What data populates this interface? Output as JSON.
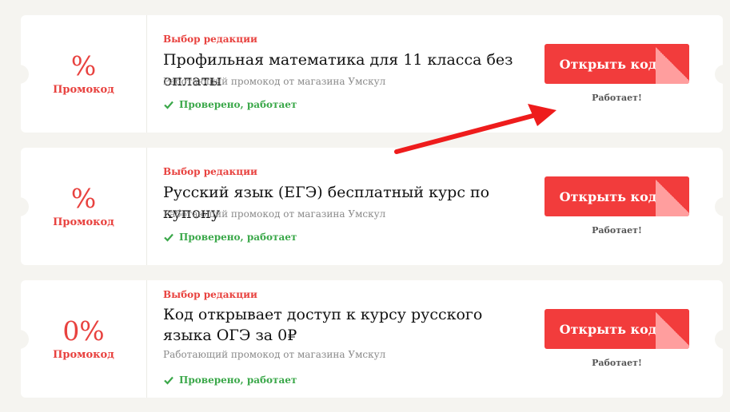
{
  "coupons": [
    {
      "discount": "%",
      "label": "Промокод",
      "editor": "Выбор редакции",
      "title": "Профильная математика для 11 класса без оплаты",
      "shop": "Работающий промокод от магазина Умскул",
      "verified": "Проверено, работает",
      "button": "Открыть код",
      "status": "Работает!"
    },
    {
      "discount": "%",
      "label": "Промокод",
      "editor": "Выбор редакции",
      "title": "Русский язык (ЕГЭ) бесплатный курс по купону",
      "shop": "Работающий промокод от магазина Умскул",
      "verified": "Проверено, работает",
      "button": "Открыть код",
      "status": "Работает!"
    },
    {
      "discount": "0%",
      "label": "Промокод",
      "editor": "Выбор редакции",
      "title": "Код открывает доступ к курсу русского языка ОГЭ за 0₽",
      "shop": "Работающий промокод от магазина Умскул",
      "verified": "Проверено, работает",
      "button": "Открыть код",
      "status": "Работает!"
    }
  ],
  "colors": {
    "accent": "#e8423f",
    "button": "#f23c3c",
    "verified": "#3ba84a",
    "background": "#f5f4f0"
  },
  "icons": {
    "check": "check-icon",
    "arrow": "red-arrow-icon"
  }
}
